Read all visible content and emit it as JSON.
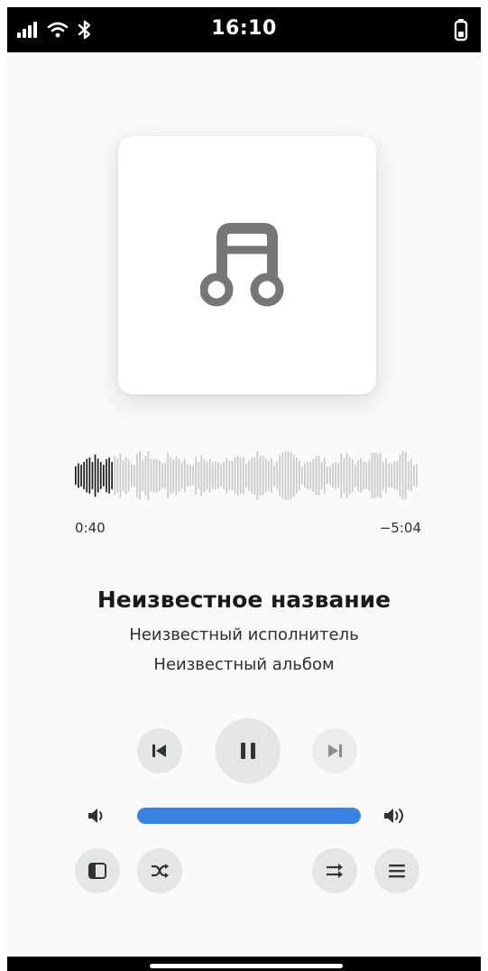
{
  "status_bar": {
    "time": "16:10",
    "icons": [
      "signal-icon",
      "wifi-icon",
      "bluetooth-icon",
      "battery-icon"
    ]
  },
  "cover": {
    "icon": "music-note-icon"
  },
  "playback": {
    "elapsed": "0:40",
    "remaining": "−5:04",
    "progress": 0.11
  },
  "track": {
    "title": "Неизвестное название",
    "artist": "Неизвестный исполнитель",
    "album": "Неизвестный альбом"
  },
  "controls": {
    "previous_icon": "skip-previous-icon",
    "play_pause_icon": "pause-icon",
    "next_icon": "skip-next-icon",
    "volume_low_icon": "volume-low-icon",
    "volume_high_icon": "volume-high-icon",
    "volume_level": 1.0,
    "sidebar_icon": "sidebar-icon",
    "shuffle_icon": "shuffle-icon",
    "repeat_icon": "repeat-icon",
    "menu_icon": "menu-icon"
  },
  "colors": {
    "accent": "#3584e4",
    "button_bg": "#e5e5e5",
    "icon": "#2e3436",
    "waveform_played": "#1c1c1c",
    "waveform_unplayed": "#c8c8c8",
    "cover_note": "#767676"
  }
}
